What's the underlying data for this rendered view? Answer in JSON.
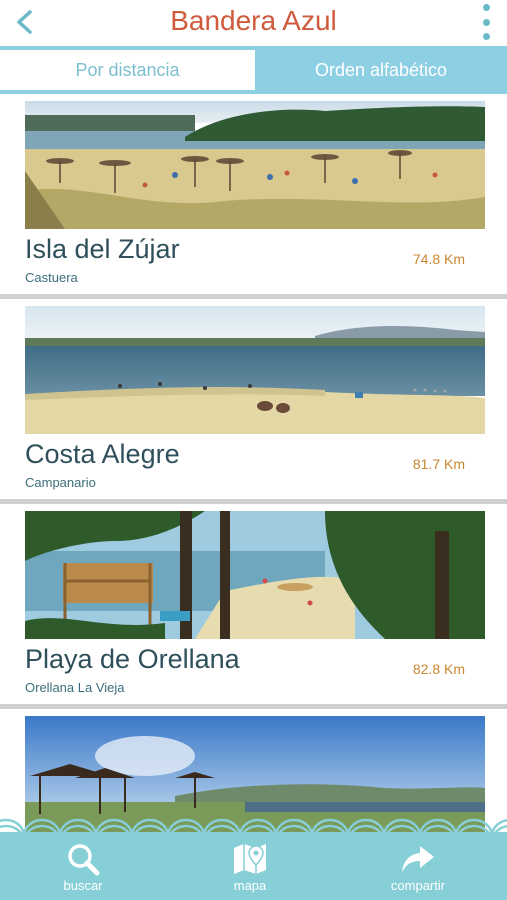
{
  "header": {
    "title": "Bandera Azul",
    "back_icon": "chevron-left-icon",
    "menu_icon": "more-vertical-icon",
    "title_color": "#cf5a3c"
  },
  "tabs": [
    {
      "label": "Por distancia",
      "active": false
    },
    {
      "label": "Orden alfabético",
      "active": true
    }
  ],
  "beaches": [
    {
      "name": "Isla del Zújar",
      "town": "Castuera",
      "distance": "74.8 Km"
    },
    {
      "name": "Costa Alegre",
      "town": "Campanario",
      "distance": "81.7 Km"
    },
    {
      "name": "Playa de Orellana",
      "town": "Orellana La Vieja",
      "distance": "82.8 Km"
    },
    {
      "name": "",
      "town": "",
      "distance": ""
    }
  ],
  "bottom_bar": {
    "buttons": [
      {
        "label": "buscar",
        "icon": "search-icon"
      },
      {
        "label": "mapa",
        "icon": "map-icon"
      },
      {
        "label": "compartir",
        "icon": "share-icon"
      }
    ],
    "color": "#86cfd6"
  }
}
